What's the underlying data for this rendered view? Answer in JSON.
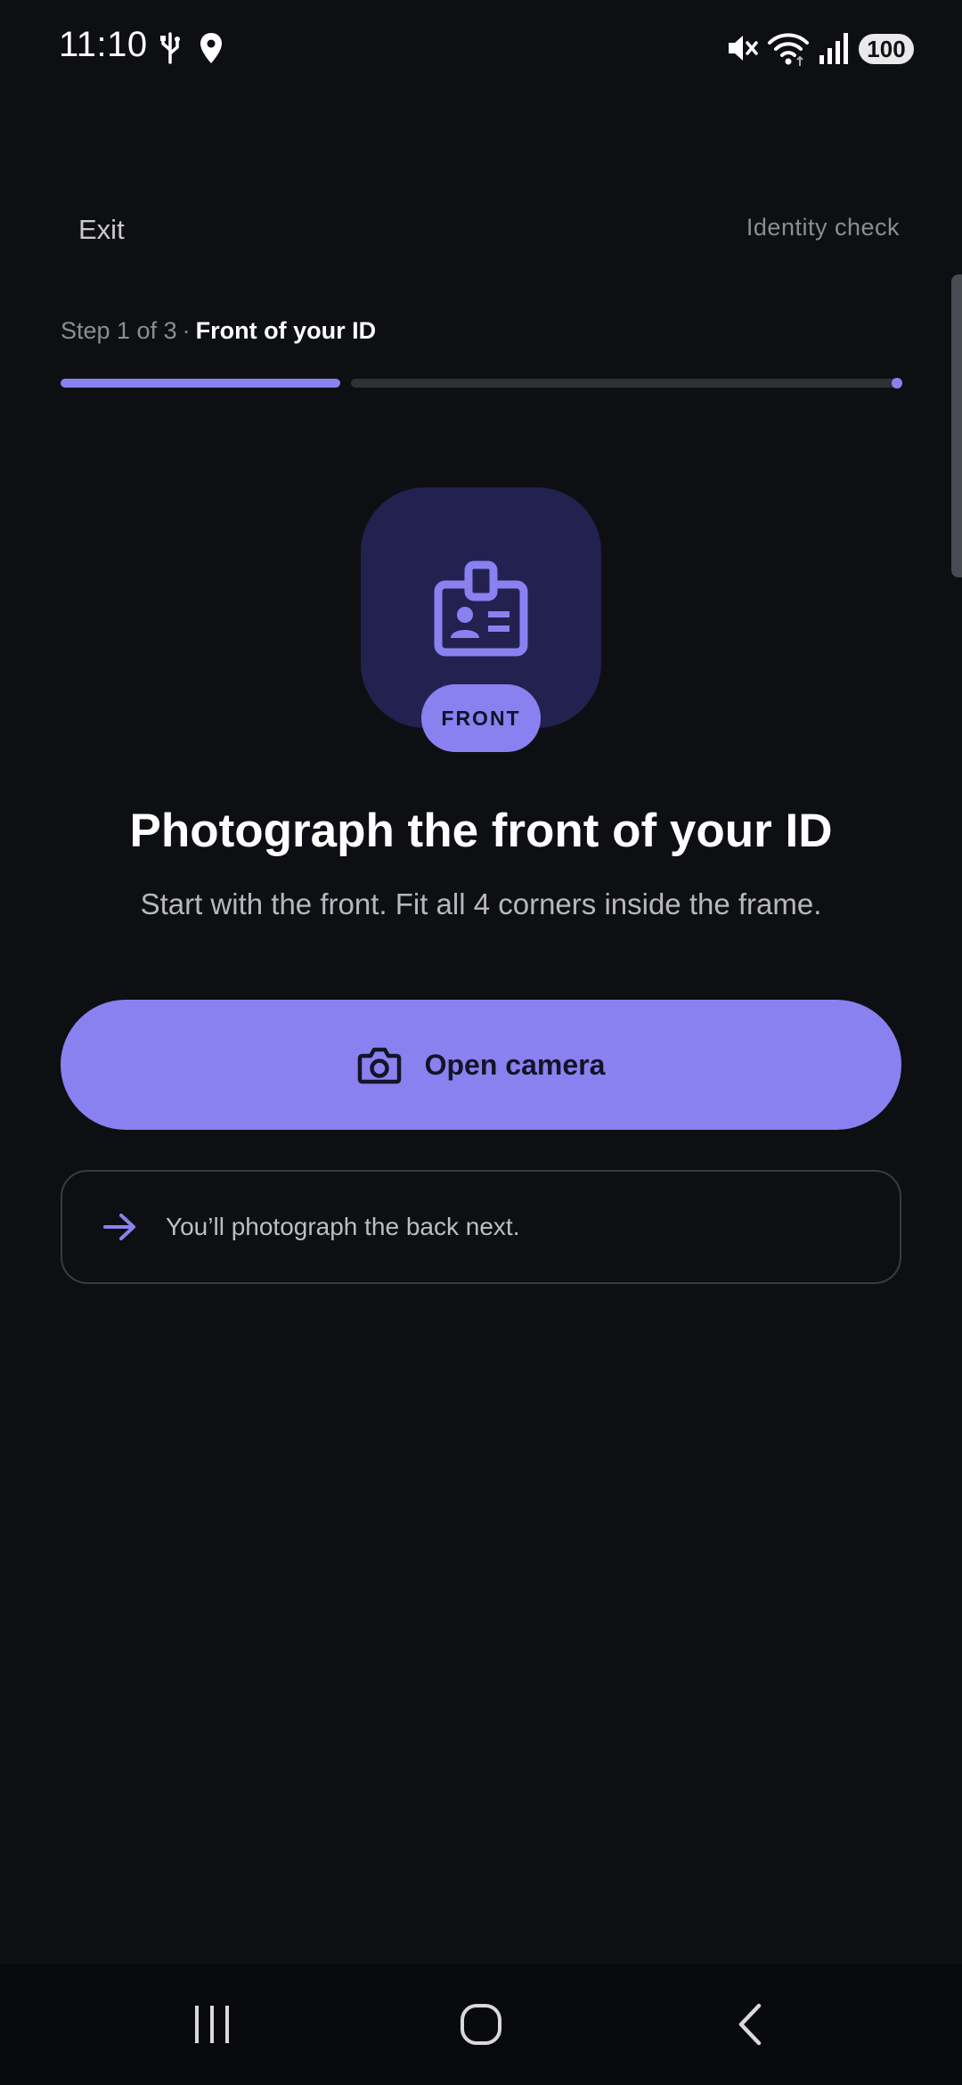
{
  "status_bar": {
    "time": "11:10",
    "battery": "100",
    "icons": [
      "usb-icon",
      "location-icon",
      "mute-icon",
      "wifi-icon",
      "signal-icon",
      "battery-icon"
    ]
  },
  "header": {
    "exit_label": "Exit",
    "page_label": "Identity check"
  },
  "step": {
    "count": "Step 1 of 3",
    "separator": "·",
    "title": "Front of your ID",
    "progress_fraction": 0.333
  },
  "hero": {
    "icon": "id-badge-icon",
    "badge": "FRONT"
  },
  "content": {
    "headline": "Photograph the front of your ID",
    "subtext": "Start with the front. Fit all 4 corners inside the frame."
  },
  "primary_action": {
    "label": "Open camera",
    "icon": "camera-icon"
  },
  "info": {
    "icon": "arrow-right-icon",
    "text": "You’ll photograph the back next."
  },
  "colors": {
    "background": "#0e0f12",
    "accent": "#8a81f0",
    "tile": "#23214f"
  },
  "nav": {
    "icons": [
      "recent-apps-icon",
      "home-icon",
      "back-icon"
    ]
  }
}
